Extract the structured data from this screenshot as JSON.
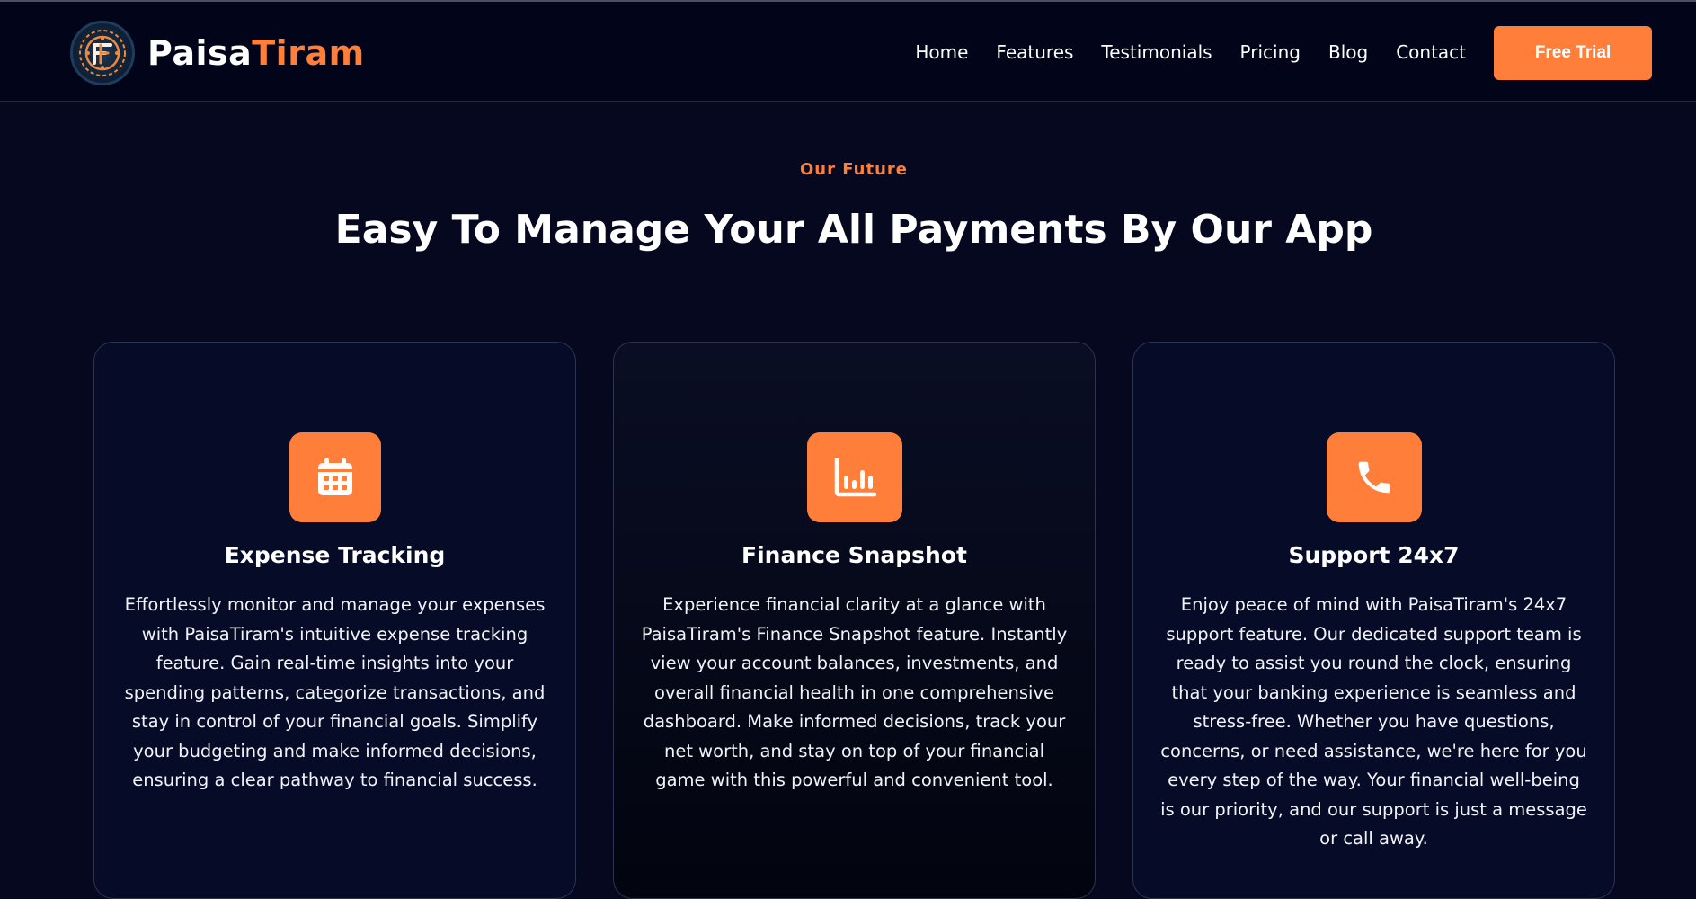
{
  "brand": {
    "name_part1": "Paisa",
    "name_part2": "Tiram",
    "accent_color": "#ff7f3a",
    "logo_icon": "paisatiram-logo-icon"
  },
  "nav": {
    "items": [
      "Home",
      "Features",
      "Testimonials",
      "Pricing",
      "Blog",
      "Contact"
    ],
    "cta_label": "Free Trial"
  },
  "section": {
    "eyebrow": "Our Future",
    "title": "Easy To Manage Your All Payments By Our App"
  },
  "features": [
    {
      "icon": "calendar-icon",
      "title": "Expense Tracking",
      "description": "Effortlessly monitor and manage your expenses with PaisaTiram's intuitive expense tracking feature. Gain real-time insights into your spending patterns, categorize transactions, and stay in control of your financial goals. Simplify your budgeting and make informed decisions, ensuring a clear pathway to financial success."
    },
    {
      "icon": "bar-chart-icon",
      "title": "Finance Snapshot",
      "description": "Experience financial clarity at a glance with PaisaTiram's Finance Snapshot feature. Instantly view your account balances, investments, and overall financial health in one comprehensive dashboard. Make informed decisions, track your net worth, and stay on top of your financial game with this powerful and convenient tool."
    },
    {
      "icon": "phone-icon",
      "title": "Support 24x7",
      "description": "Enjoy peace of mind with PaisaTiram's 24x7 support feature. Our dedicated support team is ready to assist you round the clock, ensuring that your banking experience is seamless and stress-free. Whether you have questions, concerns, or need assistance, we're here for you every step of the way. Your financial well-being is our priority, and our support is just a message or call away."
    }
  ]
}
